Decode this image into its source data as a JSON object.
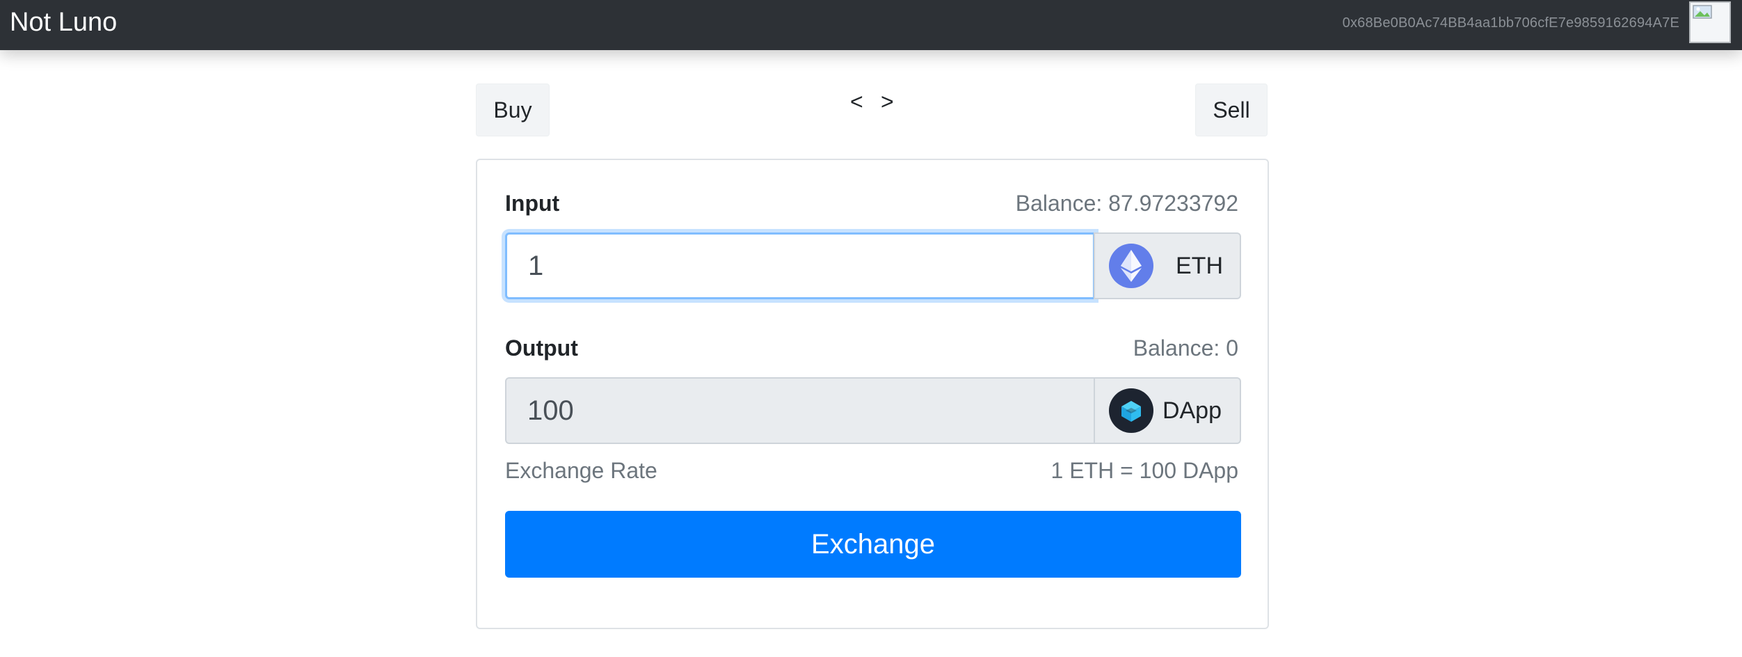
{
  "navbar": {
    "brand": "Not Luno",
    "account_address": "0x68Be0B0Ac74BB4aa1bb706cfE7e9859162694A7E"
  },
  "mode_switch": {
    "buy_label": "Buy",
    "sell_label": "Sell",
    "prev_arrow": "<",
    "next_arrow": ">"
  },
  "form": {
    "input": {
      "label": "Input",
      "balance": "Balance: 87.97233792",
      "value": "1",
      "token": "ETH",
      "token_icon": "ethereum-icon"
    },
    "output": {
      "label": "Output",
      "balance": "Balance: 0",
      "value": "100",
      "token": "DApp",
      "token_icon": "dapp-token-icon"
    },
    "exchange_rate_label": "Exchange Rate",
    "exchange_rate_value": "1 ETH = 100 DApp",
    "submit_label": "Exchange"
  },
  "colors": {
    "navbar": "#2d3136",
    "primary": "#007bff",
    "eth": "#627eea",
    "focus_border": "#80bdff"
  }
}
